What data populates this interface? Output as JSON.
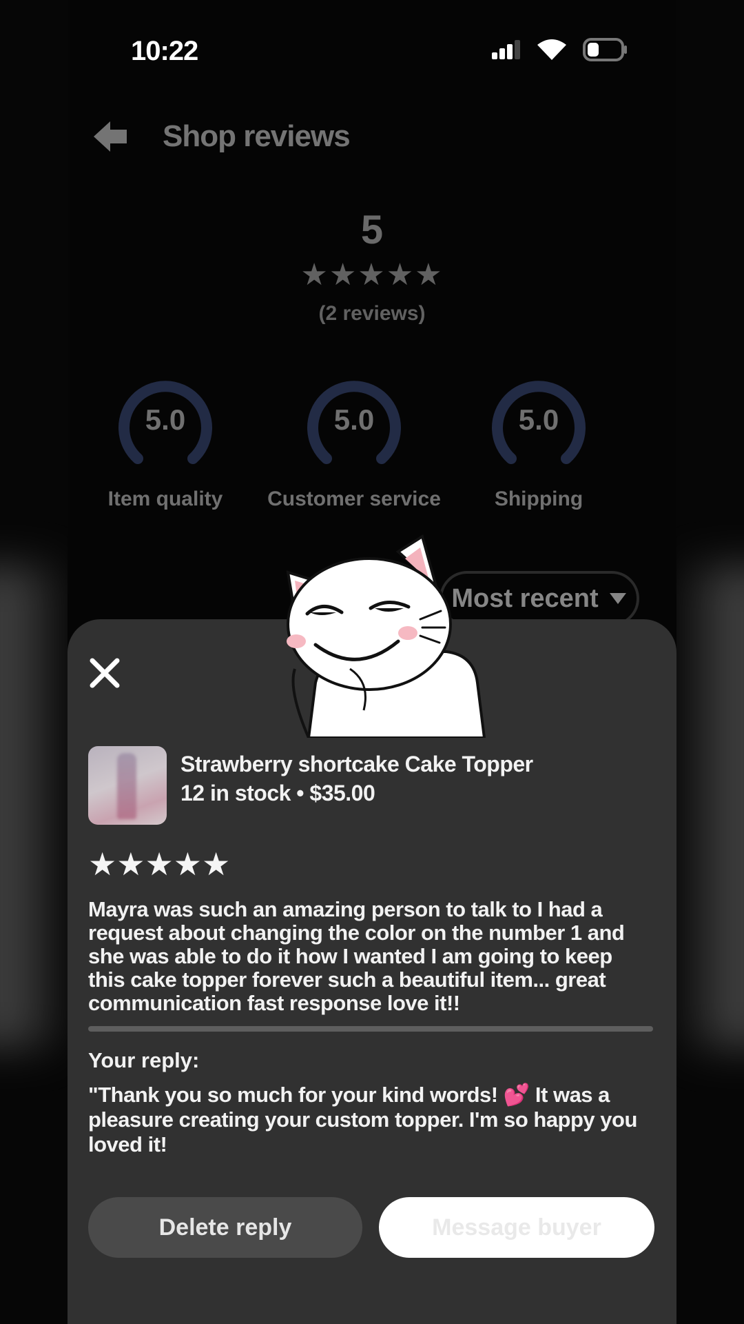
{
  "status_bar": {
    "time": "10:22"
  },
  "header": {
    "title": "Shop reviews",
    "back_icon": "arrow-left-icon"
  },
  "summary": {
    "rating": "5",
    "stars": "★★★★★",
    "review_count": "(2 reviews)"
  },
  "gauges": [
    {
      "value": "5.0",
      "label": "Item quality",
      "level": 1.0
    },
    {
      "value": "5.0",
      "label": "Customer service",
      "level": 1.0
    },
    {
      "value": "5.0",
      "label": "Shipping",
      "level": 1.0
    }
  ],
  "sort": {
    "label": "Most recent",
    "icon": "caret-down-icon"
  },
  "sheet": {
    "close_icon": "close-icon",
    "product": {
      "title": "Strawberry shortcake  Cake Topper",
      "meta": "12 in stock • $35.00"
    },
    "review_stars": "★★★★★",
    "review_text": "Mayra was such an amazing person to talk to I had a request about changing the color on the number 1 and she was able to do it how I wanted I am going to keep this cake topper forever such a beautiful item... great communication fast response love it!!",
    "reply_label": "Your reply:",
    "reply_text": "\"Thank you so much for your kind words! 💕 It was a pleasure creating your custom topper. I'm so happy you loved it!",
    "delete_button": "Delete reply",
    "message_button": "Message buyer"
  },
  "colors": {
    "background": "#050505",
    "sheet": "#313131",
    "gauge_ring": "#3b4a7a",
    "button_light": "#ffffff"
  }
}
